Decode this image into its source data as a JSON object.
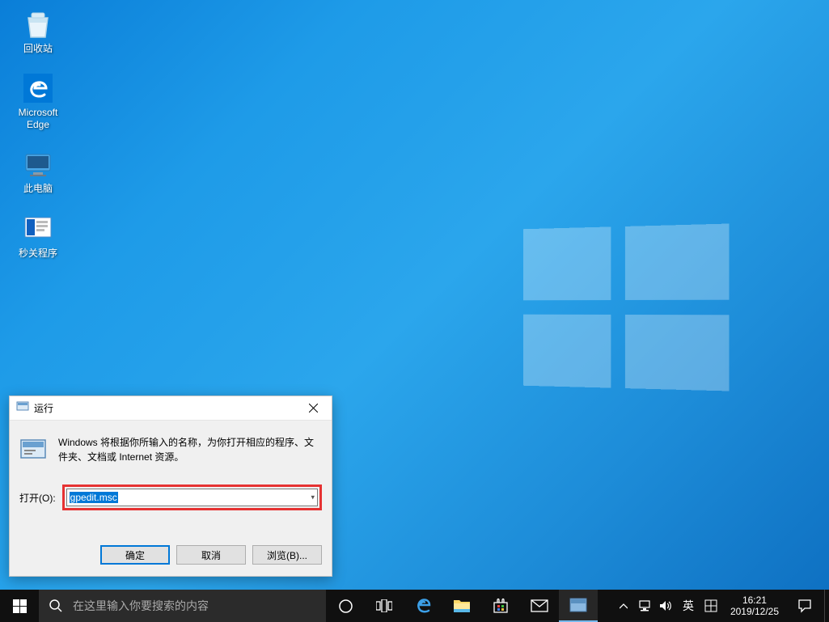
{
  "desktop": {
    "icons": [
      {
        "name": "recycle-bin",
        "label": "回收站"
      },
      {
        "name": "microsoft-edge",
        "label": "Microsoft\nEdge"
      },
      {
        "name": "this-pc",
        "label": "此电脑"
      },
      {
        "name": "seconds-shutdown",
        "label": "秒关程序"
      }
    ]
  },
  "run_dialog": {
    "title": "运行",
    "description": "Windows 将根据你所输入的名称，为你打开相应的程序、文件夹、文档或 Internet 资源。",
    "open_label": "打开(O):",
    "input_value": "gpedit.msc",
    "buttons": {
      "ok": "确定",
      "cancel": "取消",
      "browse": "浏览(B)..."
    }
  },
  "taskbar": {
    "search_placeholder": "在这里输入你要搜索的内容",
    "tray": {
      "ime": "英",
      "time": "16:21",
      "date": "2019/12/25"
    }
  }
}
